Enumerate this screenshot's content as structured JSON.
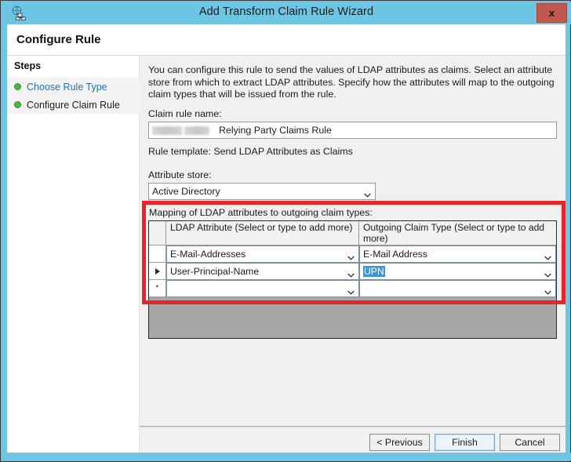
{
  "window": {
    "title": "Add Transform Claim Rule Wizard",
    "app_icon": "adfs-claim-rule-icon",
    "close_label": "x",
    "accent_color": "#6CC5E3",
    "highlight_color": "#E8232A",
    "selection_color": "#3A96DD"
  },
  "header": {
    "page_title": "Configure Rule"
  },
  "sidebar": {
    "title": "Steps",
    "items": [
      {
        "label": "Choose Rule Type",
        "state": "complete",
        "is_link": true
      },
      {
        "label": "Configure Claim Rule",
        "state": "complete",
        "is_link": false
      }
    ]
  },
  "main": {
    "intro": "You can configure this rule to send the values of LDAP attributes as claims. Select an attribute store from which to extract LDAP attributes. Specify how the attributes will map to the outgoing claim types that will be issued from the rule.",
    "claim_rule_name_label": "Claim rule name:",
    "claim_rule_name_value": "Relying Party Claims Rule",
    "claim_rule_name_redacted": true,
    "rule_template_text": "Rule template: Send LDAP Attributes as Claims",
    "attribute_store_label": "Attribute store:",
    "attribute_store_value": "Active Directory",
    "mapping_label": "Mapping of LDAP attributes to outgoing claim types:"
  },
  "grid": {
    "columns": [
      "LDAP Attribute (Select or type to add more)",
      "Outgoing Claim Type (Select or type to add more)"
    ],
    "rows": [
      {
        "marker": "",
        "ldap_attribute": "E-Mail-Addresses",
        "outgoing_claim_type": "E-Mail Address",
        "selected": false
      },
      {
        "marker": "▶",
        "ldap_attribute": "User-Principal-Name",
        "outgoing_claim_type": "UPN",
        "selected": true
      },
      {
        "marker": "*",
        "ldap_attribute": "",
        "outgoing_claim_type": "",
        "selected": false
      }
    ]
  },
  "footer": {
    "buttons": [
      {
        "label": "< Previous",
        "focused": false
      },
      {
        "label": "Finish",
        "focused": true
      },
      {
        "label": "Cancel",
        "focused": false
      }
    ]
  }
}
